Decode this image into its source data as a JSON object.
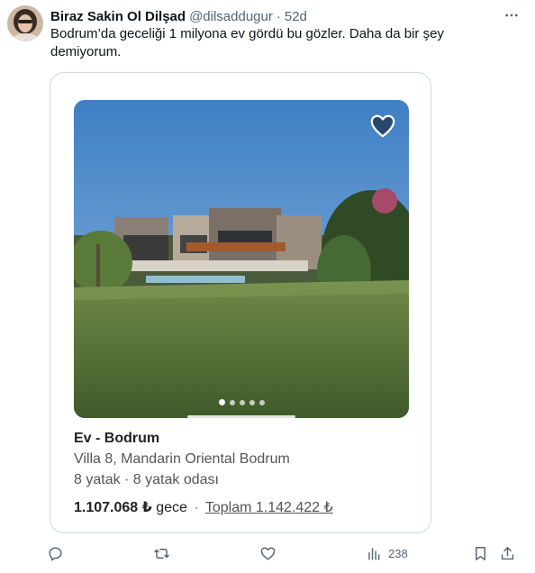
{
  "tweet": {
    "author_name": "Biraz Sakin Ol Dilşad",
    "author_handle": "@dilsaddugur",
    "separator": "·",
    "time": "52d",
    "text": "Bodrum’da geceliği 1 milyona ev gördü bu gözler. Daha da bir şey demiyorum."
  },
  "card": {
    "title": "Ev - Bodrum",
    "subtitle": "Villa 8, Mandarin Oriental Bodrum",
    "beds": "8 yatak · 8 yatak odası",
    "price": "1.107.068 ₺",
    "price_unit": "gece",
    "separator": "·",
    "total": "Toplam 1.142.422 ₺",
    "carousel": {
      "count": 5,
      "active_index": 0
    }
  },
  "actions": {
    "views_count": "238"
  },
  "icons": [
    "more-icon",
    "heart-icon",
    "reply-icon",
    "retweet-icon",
    "like-icon",
    "views-icon",
    "bookmark-icon",
    "share-icon"
  ],
  "colors": {
    "text": "#0f1419",
    "muted": "#536471",
    "border": "#cfd9de"
  }
}
